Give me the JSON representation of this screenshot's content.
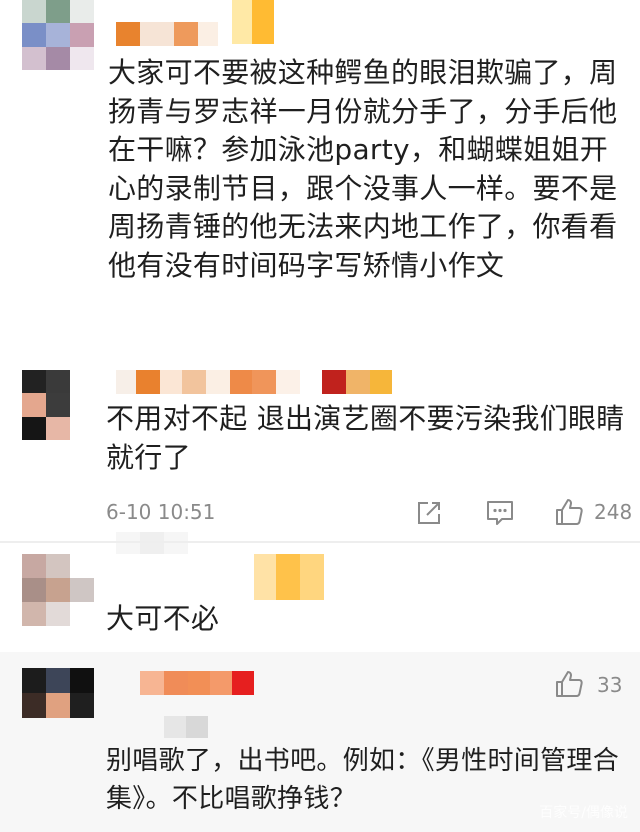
{
  "comments": [
    {
      "text": "大家可不要被这种鳄鱼的眼泪欺骗了，周扬青与罗志祥一月份就分手了，分手后他在干嘛？参加泳池party，和蝴蝶姐姐开心的录制节目，跟个没事人一样。要不是周扬青锤的他无法来内地工作了，你看看他有没有时间码字写矫情小作文"
    },
    {
      "text": "不用对不起  退出演艺圈不要污染我们眼睛就行了",
      "time": "6-10 10:51",
      "likes": "248"
    },
    {
      "text": "大可不必"
    },
    {
      "likes": "33",
      "text": "别唱歌了，出书吧。例如：《男性时间管理合集》。不比唱歌挣钱？"
    }
  ],
  "watermark": "百家号/偶像说",
  "icons": {
    "share": "share-icon",
    "comment": "comment-icon",
    "like": "thumbs-up-icon"
  }
}
